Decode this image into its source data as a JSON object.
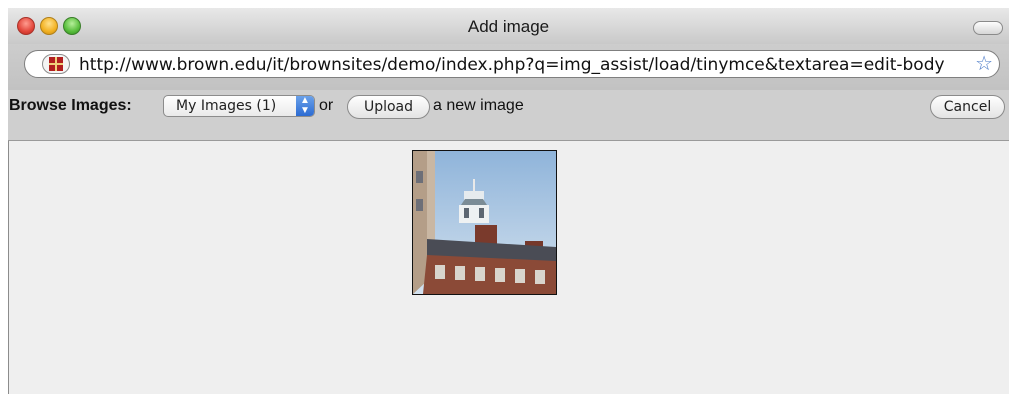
{
  "window": {
    "title": "Add image"
  },
  "address_bar": {
    "url": "http://www.brown.edu/it/brownsites/demo/index.php?q=img_assist/load/tinymce&textarea=edit-body"
  },
  "toolbar": {
    "browse_label": "Browse Images:",
    "select_value": "My Images (1)",
    "or_text": "or",
    "upload_label": "Upload",
    "after_upload_text": "a new image",
    "cancel_label": "Cancel"
  },
  "thumbnails": [
    {
      "icon": "building-photo"
    }
  ],
  "colors": {
    "close": "#e2463b",
    "minimize": "#f2b122",
    "zoom": "#58bd3c",
    "select_arrow": "#2c6bd2"
  }
}
